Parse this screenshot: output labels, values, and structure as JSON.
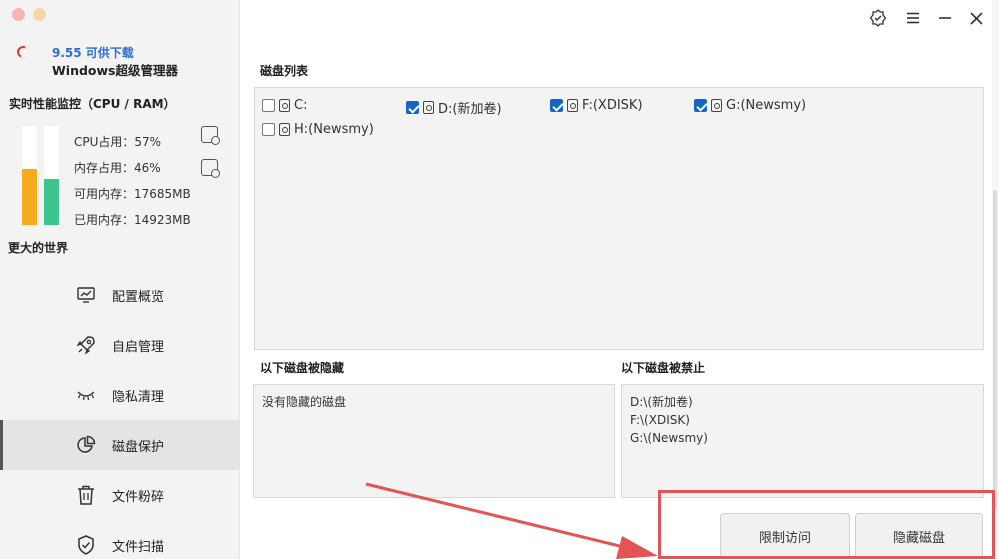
{
  "sidebar": {
    "version": "9.55 可供下载",
    "app_name": "Windows超级管理器",
    "perf_title": "实时性能监控（CPU / RAM）",
    "cpu_usage_label": "CPU占用：57%",
    "mem_usage_label": "内存占用：46%",
    "available_mem_label": "可用内存：17685MB",
    "used_mem_label": "已用内存：14923MB",
    "cpu_fraction": 0.57,
    "mem_fraction": 0.46,
    "tagline": "更大的世界",
    "nav": [
      {
        "label": "配置概览",
        "icon": "monitor-chart-icon"
      },
      {
        "label": "自启管理",
        "icon": "rocket-icon"
      },
      {
        "label": "隐私清理",
        "icon": "closed-eye-icon"
      },
      {
        "label": "磁盘保护",
        "icon": "pie-chart-icon",
        "active": true
      },
      {
        "label": "文件粉碎",
        "icon": "trash-icon"
      },
      {
        "label": "文件扫描",
        "icon": "shield-check-icon"
      }
    ]
  },
  "main": {
    "disk_list_title": "磁盘列表",
    "disks": [
      {
        "label": "C:",
        "checked": false
      },
      {
        "label": "D:(新加卷)",
        "checked": true
      },
      {
        "label": "F:(XDISK)",
        "checked": true
      },
      {
        "label": "G:(Newsmy)",
        "checked": true
      },
      {
        "label": "H:(Newsmy)",
        "checked": false
      }
    ],
    "hidden_title": "以下磁盘被隐藏",
    "hidden_text": "没有隐藏的磁盘",
    "disabled_title": "以下磁盘被禁止",
    "disabled_lines": [
      "D:\\(新加卷)",
      "F:\\(XDISK)",
      "G:\\(Newsmy)"
    ],
    "restrict_button": "限制访问",
    "hide_button": "隐藏磁盘"
  },
  "colors": {
    "cpu_bar": "#f4ab1c",
    "mem_bar": "#3dc58e",
    "accent": "#1565c8",
    "version_text": "#2b6fd6",
    "annotation": "#e35454"
  }
}
